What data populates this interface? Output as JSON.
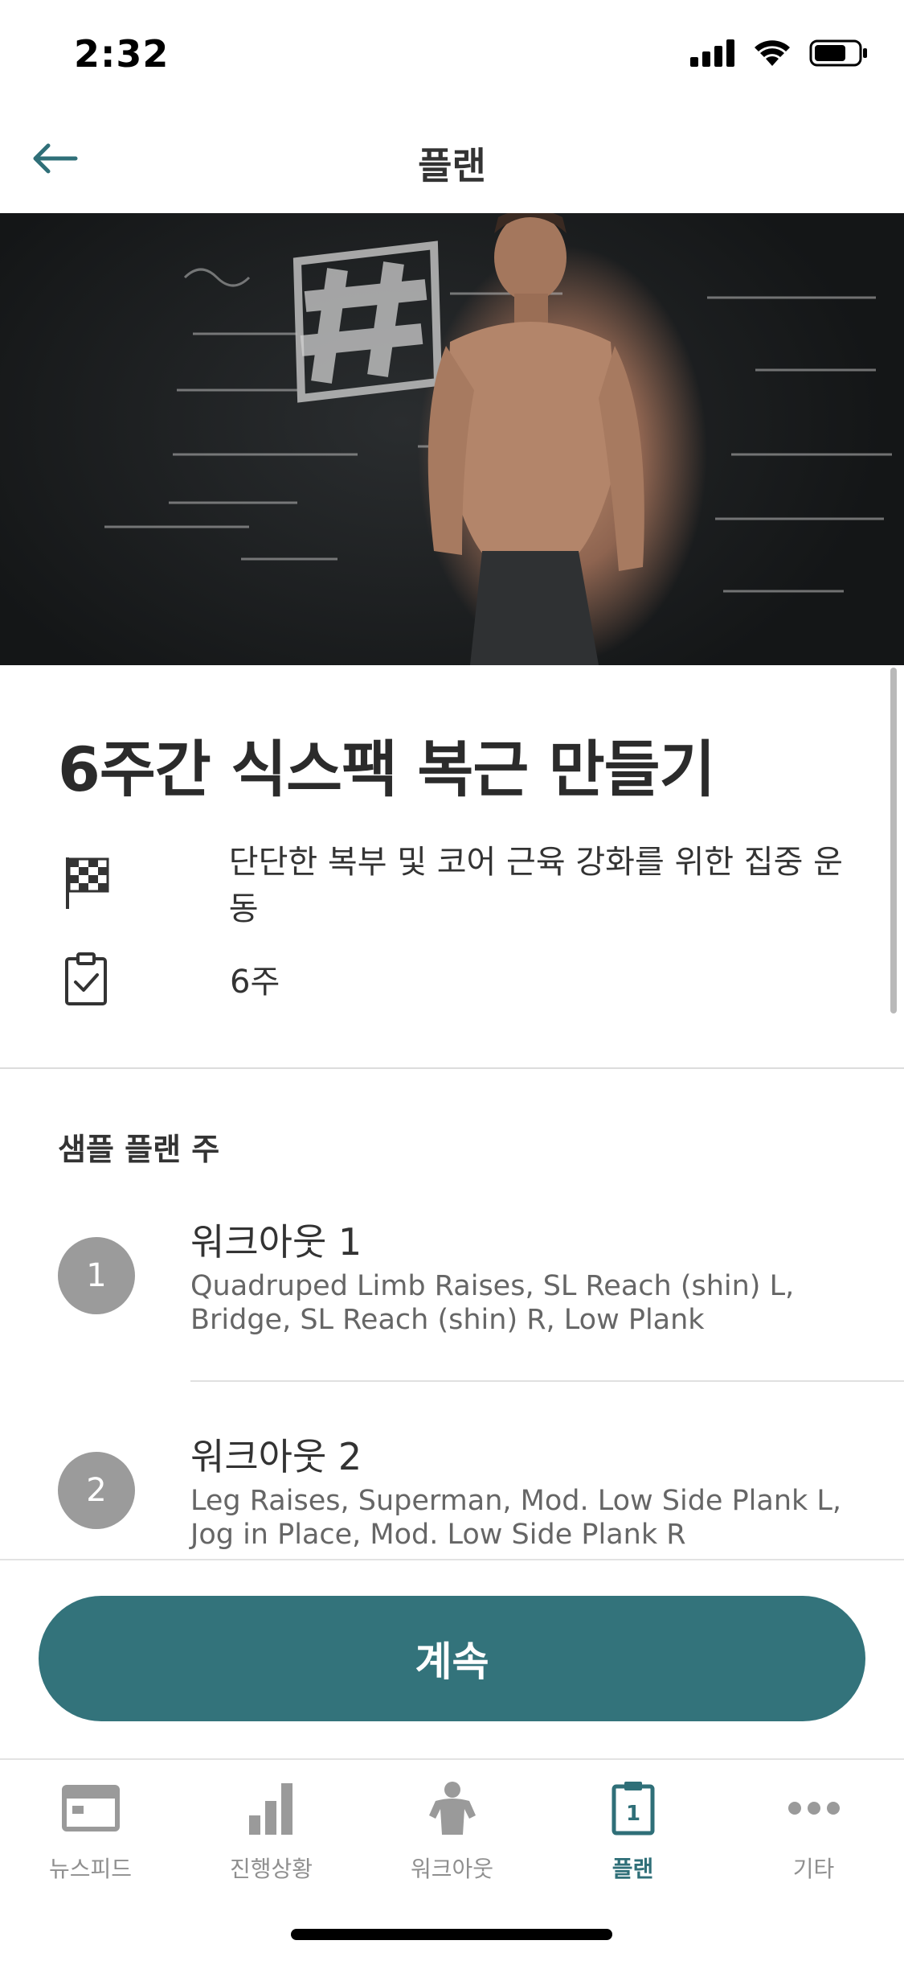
{
  "status_bar": {
    "time": "2:32"
  },
  "header": {
    "title": "플랜"
  },
  "plan": {
    "title": "6주간 식스팩 복근 만들기",
    "goal": "단단한 복부 및 코어 근육 강화를 위한 집중 운동",
    "duration": "6주"
  },
  "sample": {
    "heading": "샘플 플랜 주",
    "workouts": [
      {
        "number": "1",
        "title": "워크아웃 1",
        "exercises_line1": "Quadruped Limb Raises, SL Reach (shin) L,",
        "exercises_line2": "Bridge, SL Reach (shin) R, Low Plank"
      },
      {
        "number": "2",
        "title": "워크아웃 2",
        "exercises_line1": "Leg Raises, Superman, Mod. Low Side Plank L,",
        "exercises_line2": "Jog in Place, Mod. Low Side Plank R"
      }
    ]
  },
  "actions": {
    "continue_label": "계속"
  },
  "tabs": [
    {
      "label": "뉴스피드",
      "icon": "newsfeed-icon"
    },
    {
      "label": "진행상황",
      "icon": "bar-chart-icon"
    },
    {
      "label": "워크아웃",
      "icon": "person-icon"
    },
    {
      "label": "플랜",
      "icon": "clipboard-icon",
      "badge": "1",
      "active": true
    },
    {
      "label": "기타",
      "icon": "more-icon"
    }
  ],
  "colors": {
    "accent": "#33737b",
    "tab_active": "#2f6f78",
    "tab_inactive": "#9a9a9a",
    "circle": "#9b9b9b"
  }
}
